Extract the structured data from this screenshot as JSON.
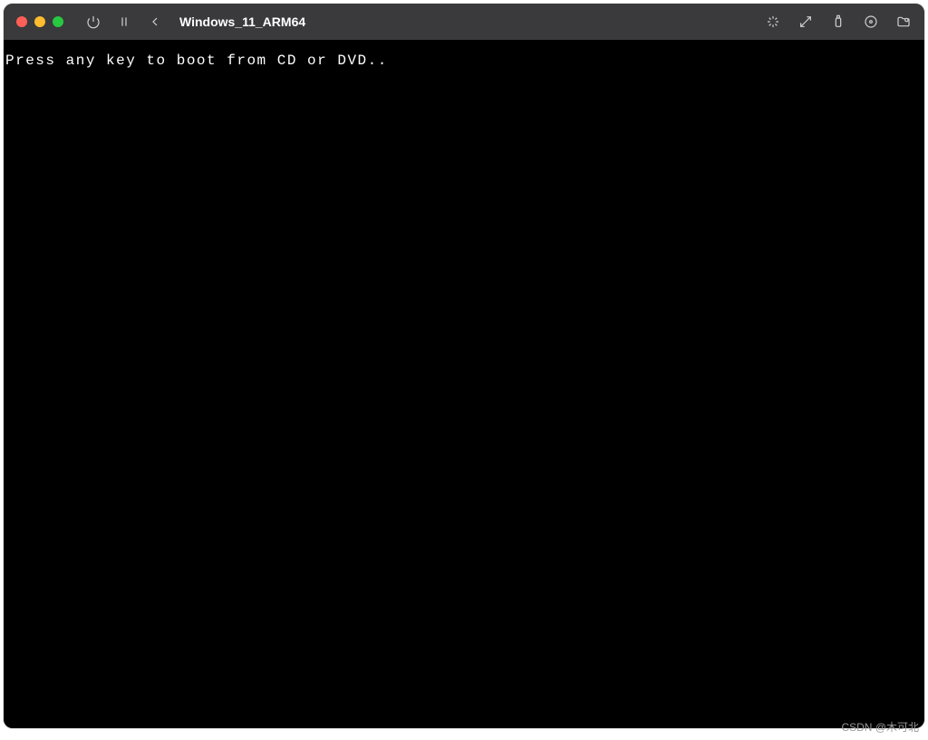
{
  "titlebar": {
    "window_title": "Windows_11_ARM64"
  },
  "icons": {
    "power": "power-icon",
    "pause": "pause-icon",
    "back": "back-icon",
    "activity": "activity-icon",
    "fullscreen": "fullscreen-icon",
    "usb": "usb-icon",
    "disc": "disc-icon",
    "folder": "folder-icon"
  },
  "vm": {
    "boot_message": "Press any key to boot from CD or DVD.."
  },
  "watermark": "CSDN @木可北"
}
